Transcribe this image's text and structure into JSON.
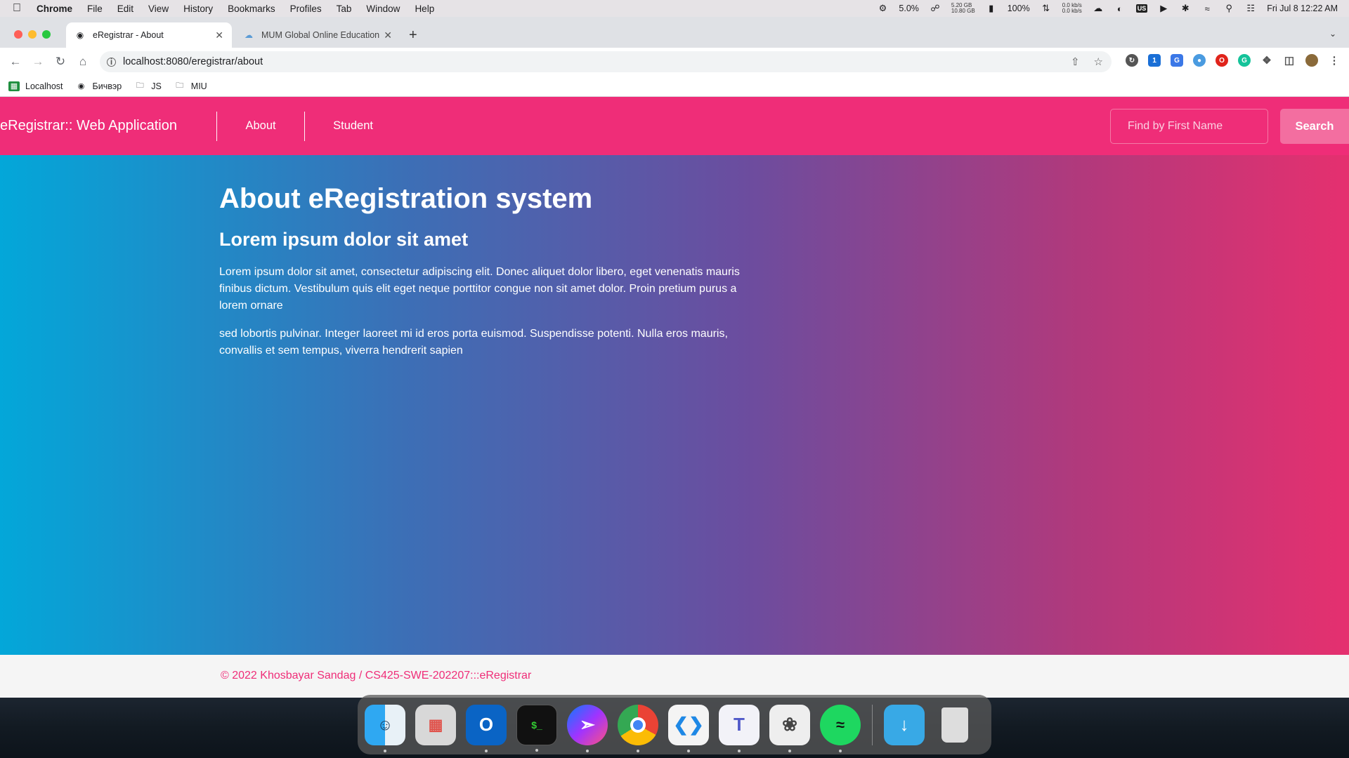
{
  "menubar": {
    "app": "Chrome",
    "items": [
      "File",
      "Edit",
      "View",
      "History",
      "Bookmarks",
      "Profiles",
      "Tab",
      "Window",
      "Help"
    ],
    "cpu": "5.0%",
    "mem_top": "5.20 GB",
    "mem_bottom": "10.80 GB",
    "battery": "100%",
    "net_up": "0.0 kb/s",
    "net_down": "0.0 kb/s",
    "input_source": "US",
    "clock": "Fri Jul 8  12:22 AM"
  },
  "browser": {
    "tabs": [
      {
        "label": "eRegistrar - About"
      },
      {
        "label": "MUM Global Online Education"
      }
    ],
    "url": "localhost:8080/eregistrar/about",
    "bookmarks": [
      "Localhost",
      "Бичвэр",
      "JS",
      "MIU"
    ]
  },
  "app": {
    "brand": "eRegistrar:: Web Application",
    "nav": [
      "About",
      "Student"
    ],
    "search_placeholder": "Find by First Name",
    "search_button": "Search",
    "heading": "About eRegistration system",
    "subheading": "Lorem ipsum dolor sit amet",
    "paragraph1": "Lorem ipsum dolor sit amet, consectetur adipiscing elit. Donec aliquet dolor libero, eget venenatis mauris finibus dictum. Vestibulum quis elit eget neque porttitor congue non sit amet dolor. Proin pretium purus a lorem ornare",
    "paragraph2": "sed lobortis pulvinar. Integer laoreet mi id eros porta euismod. Suspendisse potenti. Nulla eros mauris, convallis et sem tempus, viverra hendrerit sapien",
    "footer": "© 2022 Khosbayar Sandag / CS425-SWE-202207:::eRegistrar"
  },
  "colors": {
    "brand_pink": "#ef2d78",
    "gradient_start": "#03a7d9",
    "gradient_end": "#e5306f"
  },
  "dock": [
    "finder-icon",
    "launchpad-icon",
    "outlook-icon",
    "terminal-icon",
    "messenger-icon",
    "chrome-icon",
    "vscode-icon",
    "teams-icon",
    "sequel-ace-icon",
    "spotify-icon",
    "downloads-folder-icon",
    "trash-icon"
  ]
}
